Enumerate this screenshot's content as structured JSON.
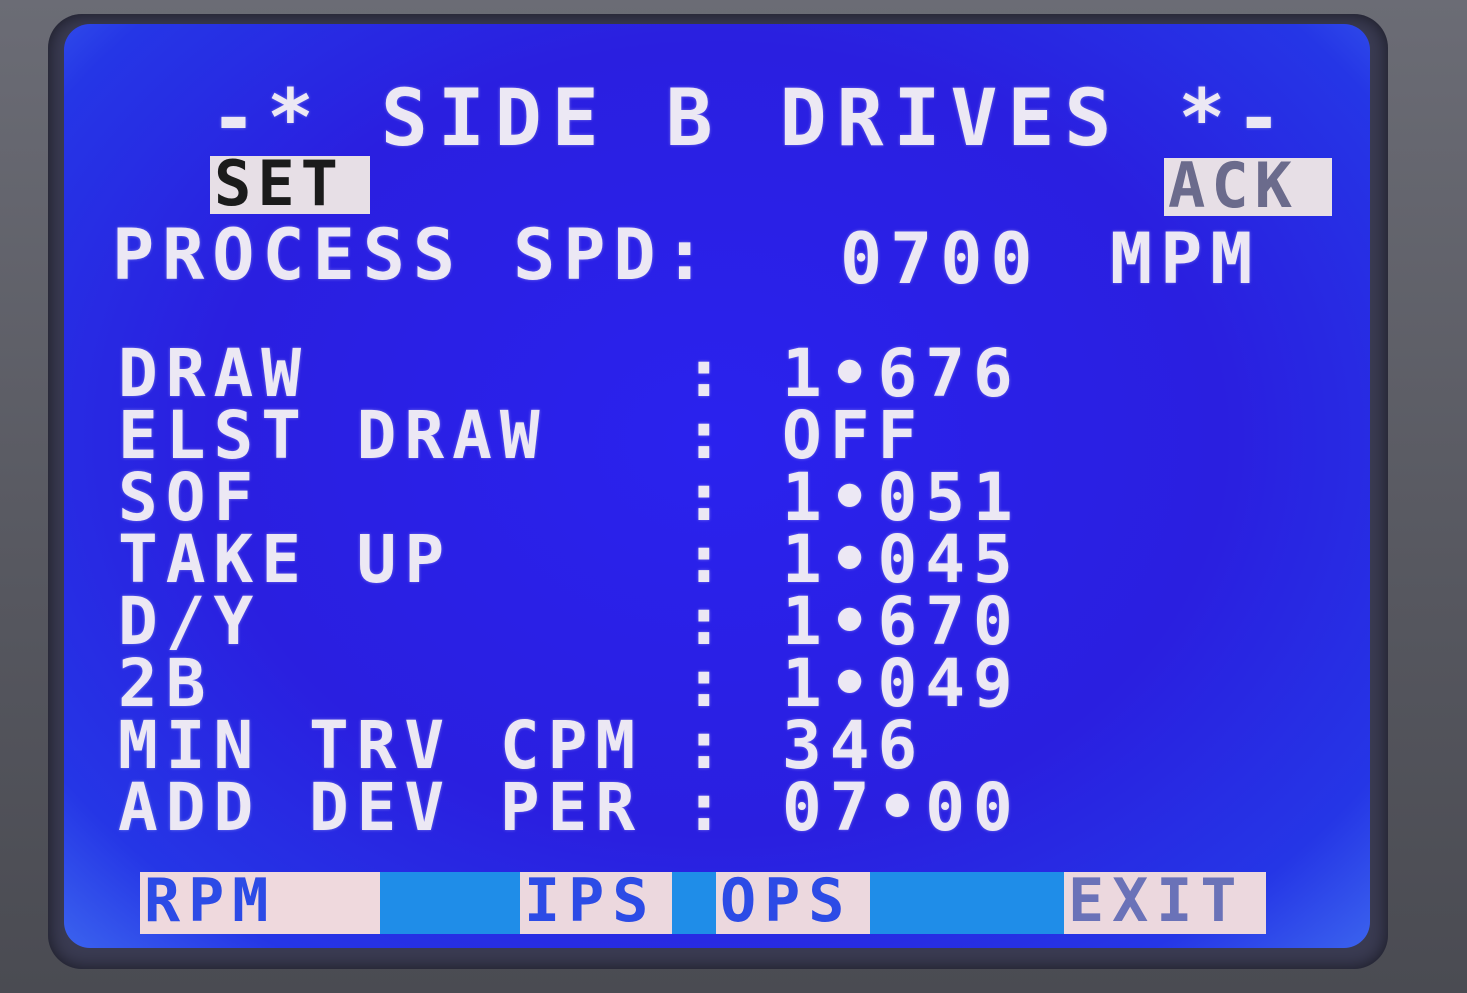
{
  "screen": {
    "title": "-* SIDE B DRIVES *-",
    "set_key": "SET",
    "ack_key": "ACK",
    "process_speed": {
      "label": "PROCESS SPD:",
      "value": "0700",
      "unit": "MPM"
    },
    "params": [
      {
        "label": "DRAW",
        "colon": ":",
        "value": "1•676"
      },
      {
        "label": "ELST DRAW",
        "colon": ":",
        "value": "OFF"
      },
      {
        "label": "SOF",
        "colon": ":",
        "value": "1•051"
      },
      {
        "label": "TAKE UP",
        "colon": ":",
        "value": "1•045"
      },
      {
        "label": "D/Y",
        "colon": ":",
        "value": "1•670"
      },
      {
        "label": "2B",
        "colon": ":",
        "value": "1•049"
      },
      {
        "label": "MIN TRV CPM",
        "colon": ":",
        "value": "346"
      },
      {
        "label": "ADD DEV PER",
        "colon": ":",
        "value": "07•00"
      }
    ],
    "function_keys": [
      "RPM",
      "IPS",
      "OPS",
      "EXIT"
    ]
  },
  "colors": {
    "screen_background": "#2a22ee",
    "text": "#ece8f4",
    "soft_key_background": "#e7dfe6",
    "function_strip": "#1f8de8"
  }
}
